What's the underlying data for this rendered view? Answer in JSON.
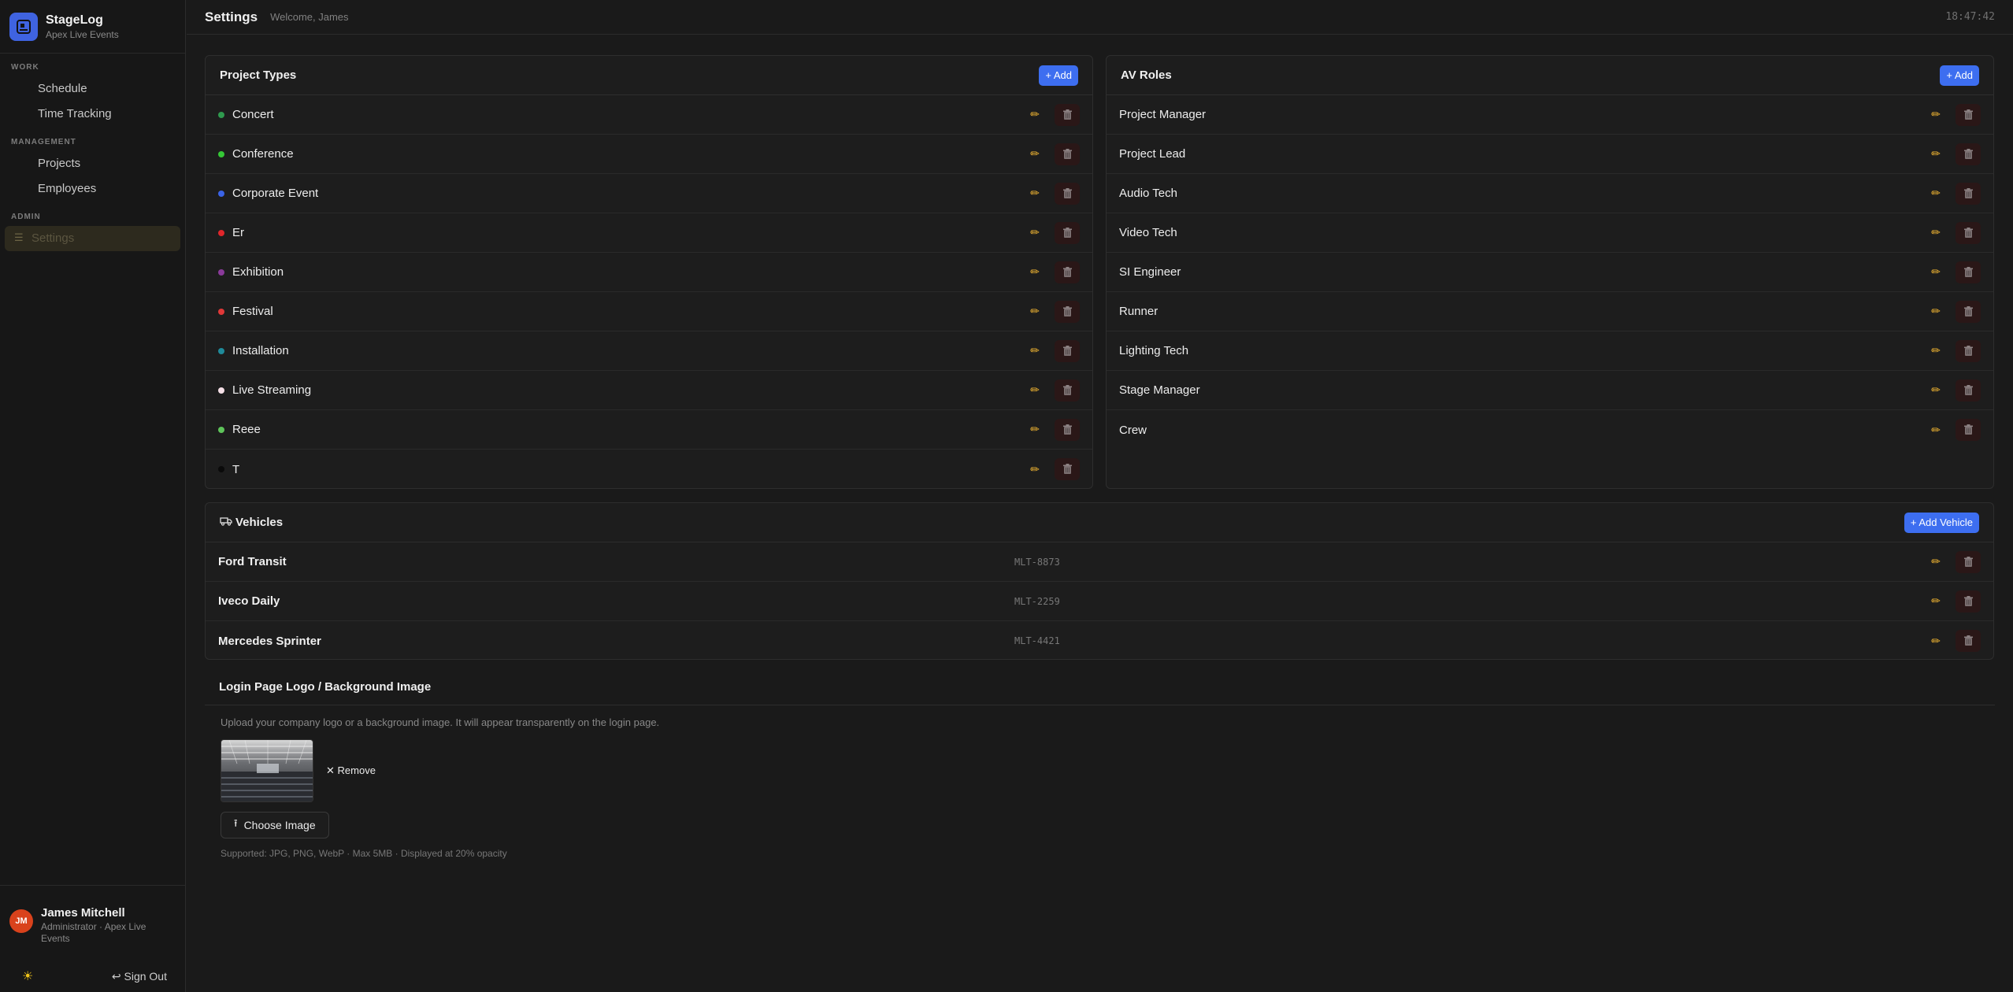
{
  "brand": {
    "title": "StageLog",
    "subtitle": "Apex Live Events"
  },
  "nav": {
    "sections": [
      {
        "label": "WORK",
        "items": [
          "Schedule",
          "Time Tracking"
        ]
      },
      {
        "label": "MANAGEMENT",
        "items": [
          "Projects",
          "Employees"
        ]
      },
      {
        "label": "ADMIN",
        "items": [
          "Settings"
        ]
      }
    ],
    "active": "Settings"
  },
  "user": {
    "initials": "JM",
    "name": "James Mitchell",
    "role": "Administrator · Apex Live Events"
  },
  "bottom": {
    "signout": "↩ Sign Out",
    "theme_icon": "sun-icon"
  },
  "header": {
    "title": "Settings",
    "welcome": "Welcome, James",
    "time": "18:47:42"
  },
  "project_types": {
    "title": "Project Types",
    "add_label": "+ Add",
    "items": [
      {
        "label": "Concert",
        "color": "#2f9a4e"
      },
      {
        "label": "Conference",
        "color": "#35c736"
      },
      {
        "label": "Corporate Event",
        "color": "#3a63e6"
      },
      {
        "label": "Er",
        "color": "#e0262b"
      },
      {
        "label": "Exhibition",
        "color": "#8a3a9a"
      },
      {
        "label": "Festival",
        "color": "#e03838"
      },
      {
        "label": "Installation",
        "color": "#1f8a9a"
      },
      {
        "label": "Live Streaming",
        "color": "#f4dfe6"
      },
      {
        "label": "Reee",
        "color": "#5ec45a"
      },
      {
        "label": "T",
        "color": "#0a0a0a"
      }
    ]
  },
  "av_roles": {
    "title": "AV Roles",
    "add_label": "+ Add",
    "items": [
      "Project Manager",
      "Project Lead",
      "Audio Tech",
      "Video Tech",
      "SI Engineer",
      "Runner",
      "Lighting Tech",
      "Stage Manager",
      "Crew"
    ]
  },
  "vehicles": {
    "title": "Vehicles",
    "add_label": "+ Add Vehicle",
    "items": [
      {
        "name": "Ford Transit",
        "plate": "MLT-8873"
      },
      {
        "name": "Iveco Daily",
        "plate": "MLT-2259"
      },
      {
        "name": "Mercedes Sprinter",
        "plate": "MLT-4421"
      }
    ]
  },
  "login_image": {
    "title": "Login Page Logo / Background Image",
    "description": "Upload your company logo or a background image. It will appear transparently on the login page.",
    "remove_label": "Remove",
    "choose_label": "Choose Image",
    "hint": "Supported: JPG, PNG, WebP · Max 5MB · Displayed at 20% opacity"
  },
  "colors": {
    "accent": "#3d6ef0",
    "edit": "#f2b632",
    "delete_bg": "#2a1717",
    "avatar": "#d9421c"
  }
}
